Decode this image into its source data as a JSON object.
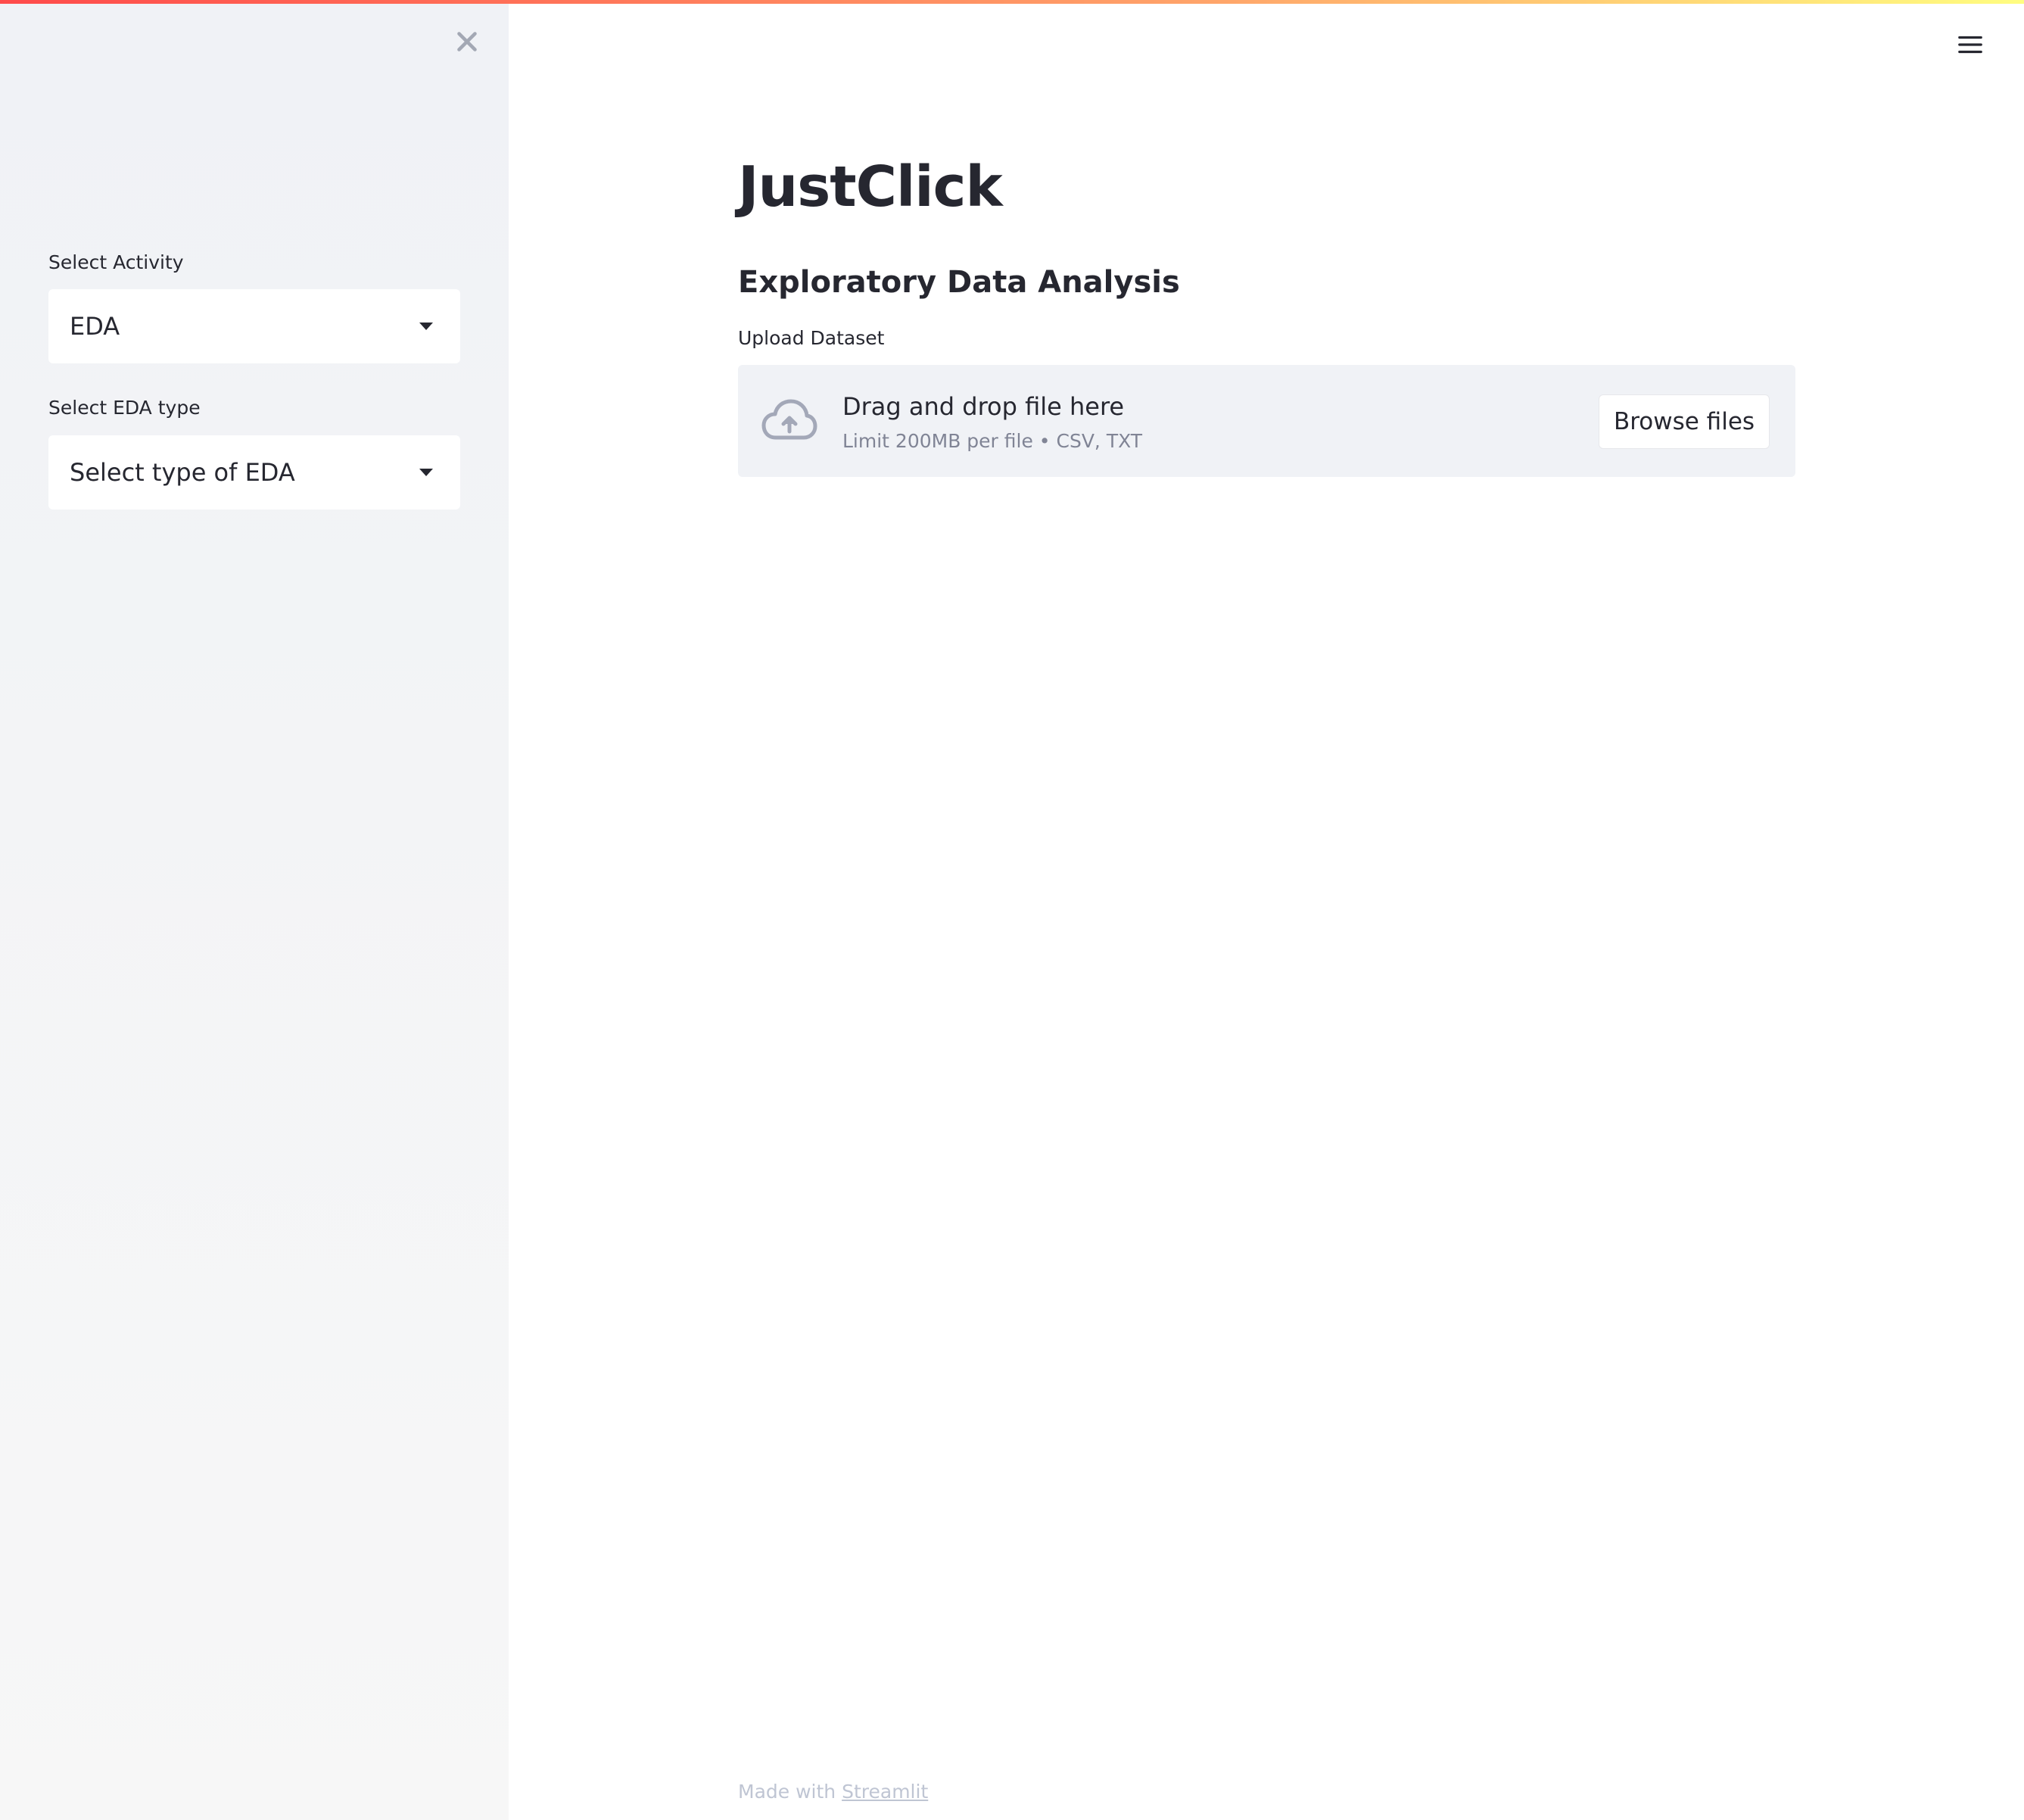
{
  "app": {
    "title": "JustClick",
    "accent_colors": [
      "#ff4b4b",
      "#ffa56a",
      "#fffd80"
    ]
  },
  "sidebar": {
    "close_icon": "close-icon",
    "activity": {
      "label": "Select Activity",
      "value": "EDA"
    },
    "eda_type": {
      "label": "Select EDA type",
      "value": "Select type of EDA"
    }
  },
  "header": {
    "menu_icon": "hamburger-menu-icon"
  },
  "main": {
    "section_title": "Exploratory Data Analysis",
    "uploader": {
      "label": "Upload Dataset",
      "icon": "cloud-upload-icon",
      "instruction": "Drag and drop file here",
      "limit_text": "Limit 200MB per file • CSV, TXT",
      "browse_label": "Browse files"
    }
  },
  "footer": {
    "prefix": "Made with",
    "link_text": "Streamlit"
  }
}
